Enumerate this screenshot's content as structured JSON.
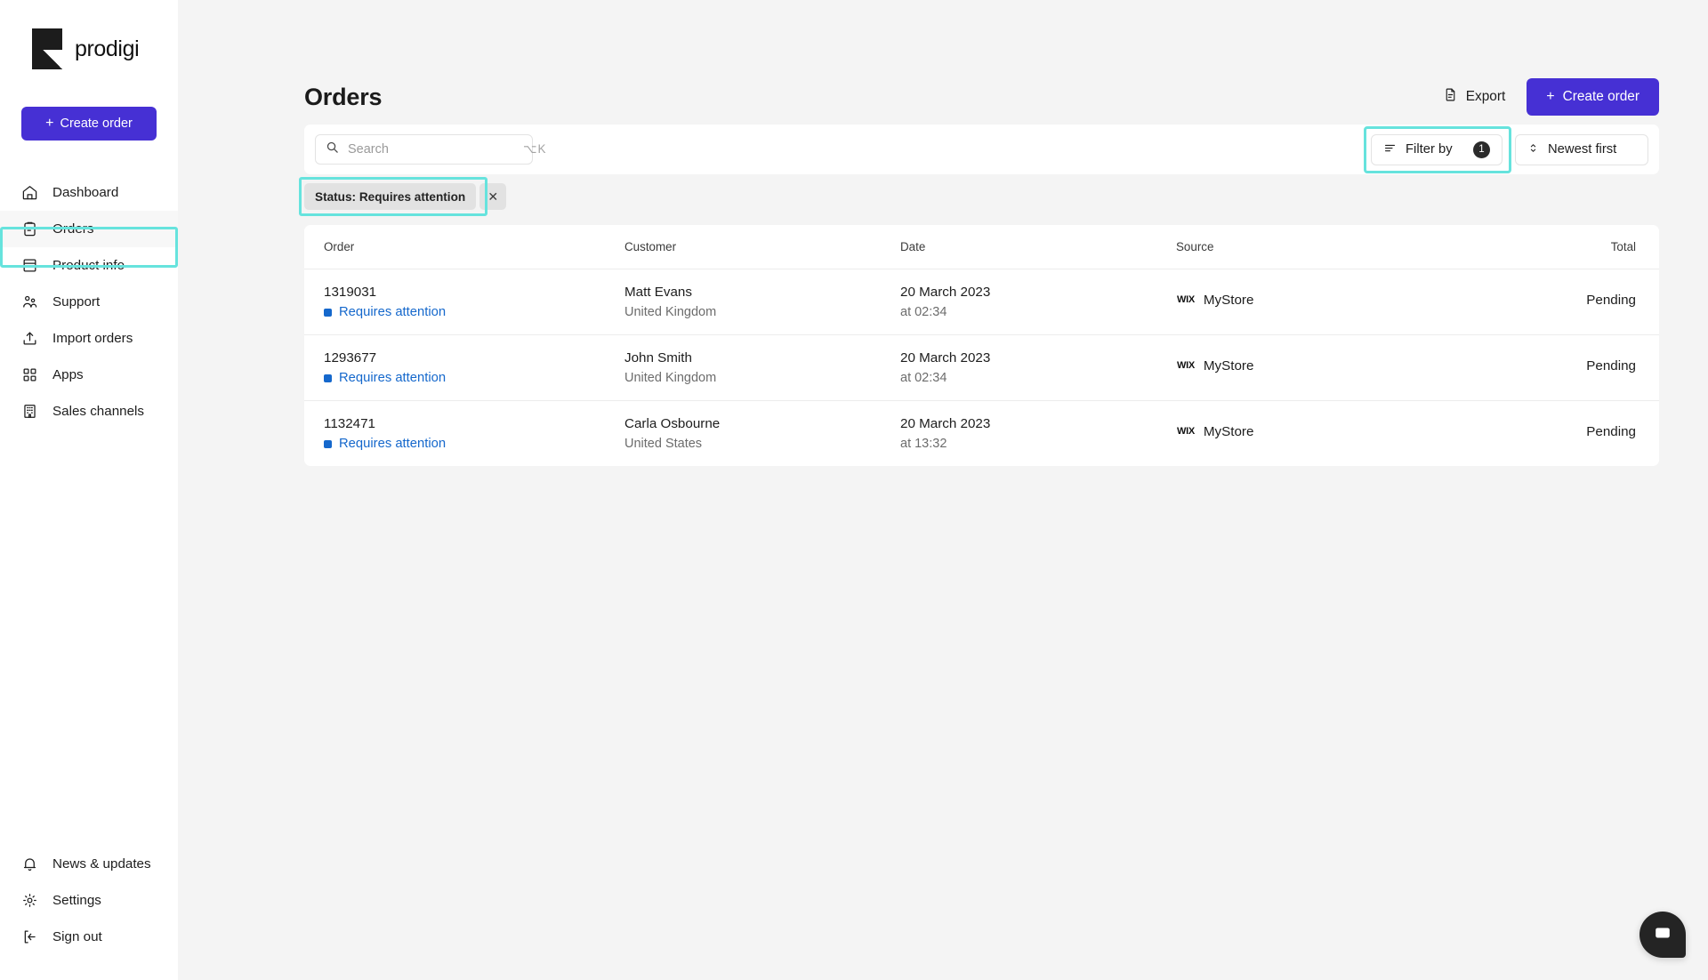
{
  "brand": {
    "name": "prodigi",
    "logo_icon": "prodigi-logo-mark"
  },
  "sidebar": {
    "create_order_label": "Create order",
    "top_items": [
      {
        "label": "Dashboard",
        "icon": "home-icon",
        "active": false
      },
      {
        "label": "Orders",
        "icon": "clipboard-icon",
        "active": true
      },
      {
        "label": "Product info",
        "icon": "archive-box-icon",
        "active": false
      },
      {
        "label": "Support",
        "icon": "users-icon",
        "active": false
      },
      {
        "label": "Import orders",
        "icon": "upload-icon",
        "active": false
      },
      {
        "label": "Apps",
        "icon": "grid-squares-icon",
        "active": false
      },
      {
        "label": "Sales channels",
        "icon": "building-icon",
        "active": false
      }
    ],
    "bottom_items": [
      {
        "label": "News & updates",
        "icon": "bell-icon"
      },
      {
        "label": "Settings",
        "icon": "gear-icon"
      },
      {
        "label": "Sign out",
        "icon": "sign-out-icon"
      }
    ]
  },
  "header": {
    "title": "Orders",
    "export_label": "Export",
    "create_order_label": "Create order"
  },
  "toolbar": {
    "search": {
      "value": "",
      "placeholder": "Search",
      "shortcut": "⌥K"
    },
    "filter": {
      "label": "Filter by",
      "badge": "1",
      "icon": "filter-lines-icon"
    },
    "sort": {
      "label": "Newest first",
      "icon": "sort-chevrons-icon"
    }
  },
  "filter_chips": [
    {
      "label": "Status: Requires attention",
      "remove_icon": "close-icon"
    }
  ],
  "table": {
    "columns": [
      "Order",
      "Customer",
      "Date",
      "Source",
      "Total"
    ],
    "rows": [
      {
        "order_id": "1319031",
        "status": "Requires attention",
        "customer_name": "Matt Evans",
        "customer_country": "United Kingdom",
        "date": "20 March 2023",
        "time": "at 02:34",
        "source_logo": "wix-logo",
        "source_brand": "WIX",
        "source_name": "MyStore",
        "total": "Pending"
      },
      {
        "order_id": "1293677",
        "status": "Requires attention",
        "customer_name": "John Smith",
        "customer_country": "United Kingdom",
        "date": "20 March 2023",
        "time": "at 02:34",
        "source_logo": "wix-logo",
        "source_brand": "WIX",
        "source_name": "MyStore",
        "total": "Pending"
      },
      {
        "order_id": "1132471",
        "status": "Requires attention",
        "customer_name": "Carla Osbourne",
        "customer_country": "United States",
        "date": "20 March 2023",
        "time": "at 13:32",
        "source_logo": "wix-logo",
        "source_brand": "WIX",
        "source_name": "MyStore",
        "total": "Pending"
      }
    ]
  },
  "chat": {
    "icon": "chat-bubble-icon"
  },
  "colors": {
    "brand_purple": "#4630d4",
    "status_blue": "#1568cc",
    "highlight_cyan": "#66e3dd",
    "page_background": "#f4f4f4",
    "badge_dark": "#2b2b2b"
  }
}
